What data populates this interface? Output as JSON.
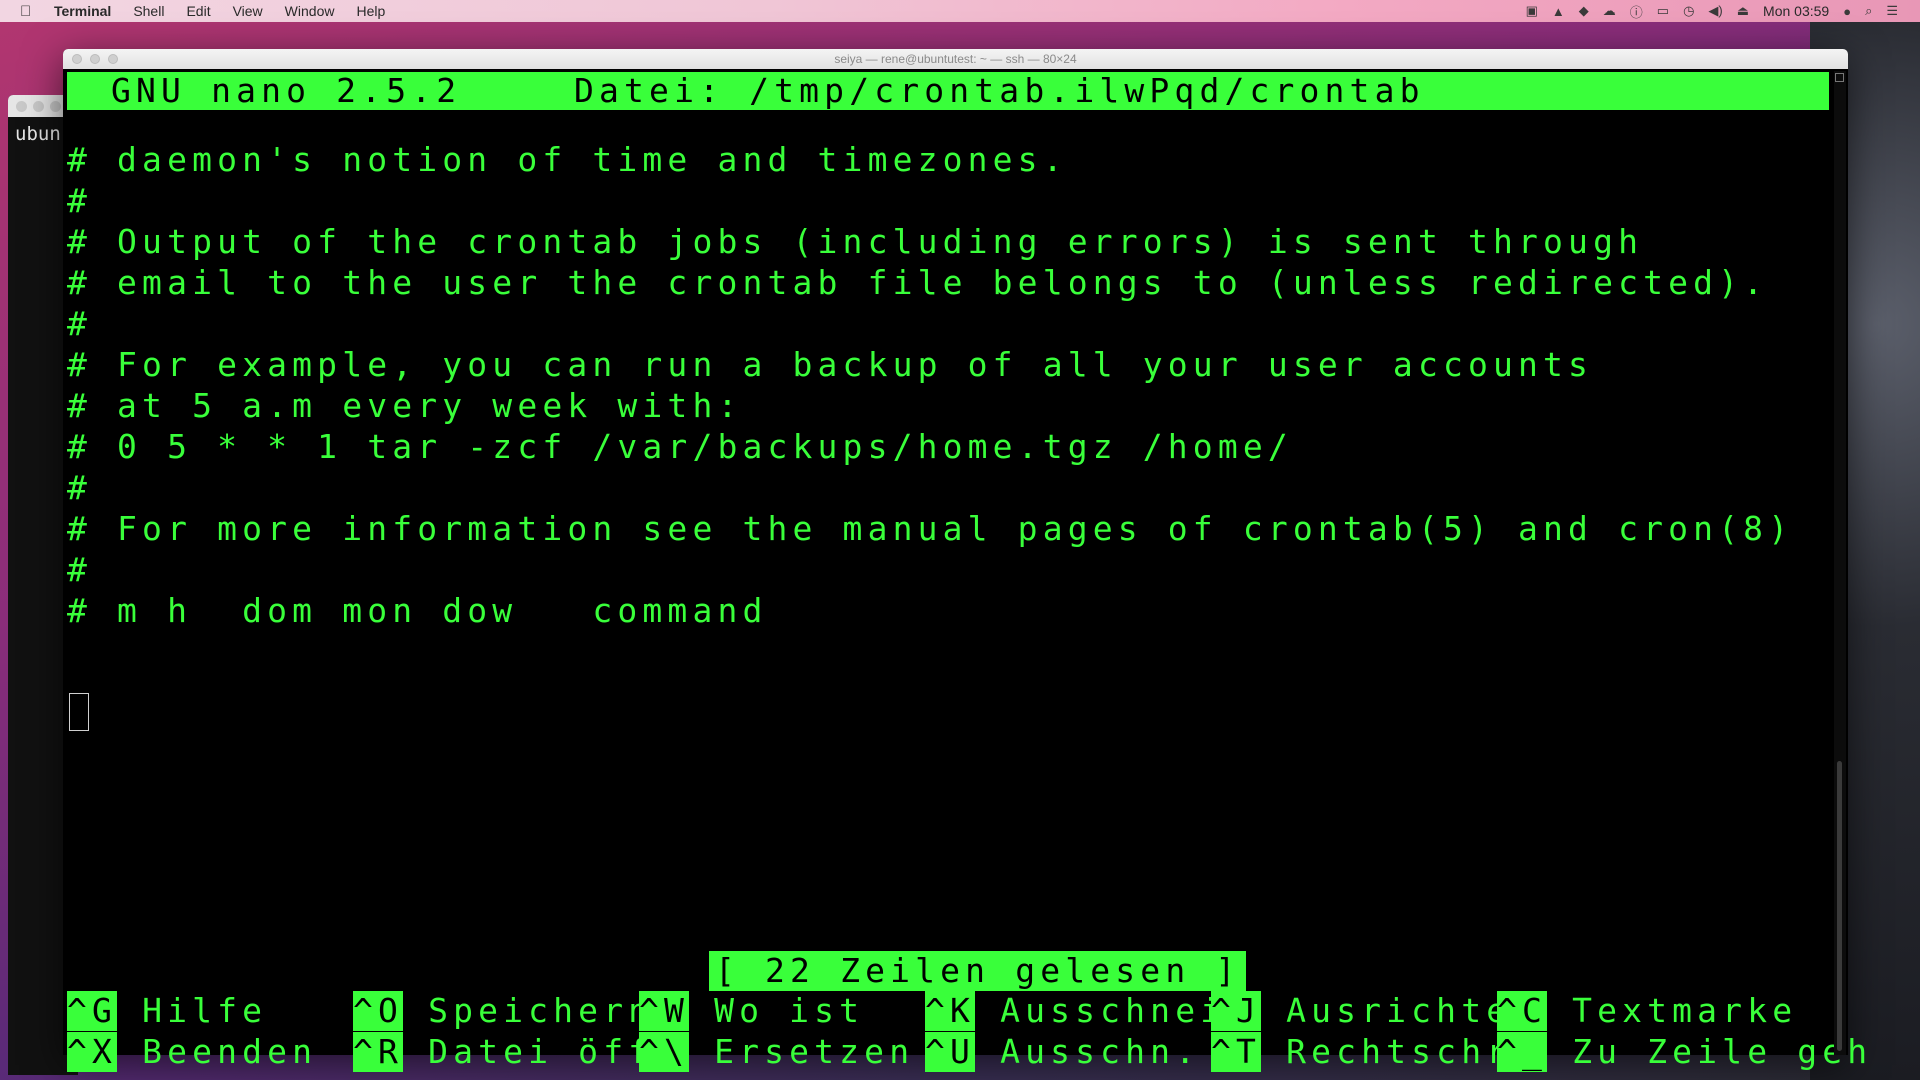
{
  "menubar": {
    "app": "Terminal",
    "items": [
      "Shell",
      "Edit",
      "View",
      "Window",
      "Help"
    ],
    "clock": "Mon 03:59"
  },
  "bg_window": {
    "text": "ubun"
  },
  "window": {
    "title": "seiya — rene@ubuntutest: ~ — ssh — 80×24"
  },
  "nano": {
    "version": "GNU nano 2.5.2",
    "file": "Datei: /tmp/crontab.ilwPqd/crontab",
    "lines": [
      "# daemon's notion of time and timezones.",
      "#",
      "# Output of the crontab jobs (including errors) is sent through",
      "# email to the user the crontab file belongs to (unless redirected).",
      "#",
      "# For example, you can run a backup of all your user accounts",
      "# at 5 a.m every week with:",
      "# 0 5 * * 1 tar -zcf /var/backups/home.tgz /home/",
      "#",
      "# For more information see the manual pages of crontab(5) and cron(8)",
      "#",
      "# m h  dom mon dow   command"
    ],
    "status": "[ 22 Zeilen gelesen ]",
    "shortcuts_row1": [
      {
        "key": "^G",
        "label": " Hilfe"
      },
      {
        "key": "^O",
        "label": " Speichern"
      },
      {
        "key": "^W",
        "label": " Wo ist"
      },
      {
        "key": "^K",
        "label": " Ausschneid"
      },
      {
        "key": "^J",
        "label": " Ausrichten"
      },
      {
        "key": "^C",
        "label": " Textmarke"
      }
    ],
    "shortcuts_row2": [
      {
        "key": "^X",
        "label": " Beenden"
      },
      {
        "key": "^R",
        "label": " Datei öffn"
      },
      {
        "key": "^\\",
        "label": " Ersetzen"
      },
      {
        "key": "^U",
        "label": " Ausschn. r"
      },
      {
        "key": "^T",
        "label": " Rechtschr."
      },
      {
        "key": "^_",
        "label": " Zu Zeile geh"
      }
    ]
  }
}
